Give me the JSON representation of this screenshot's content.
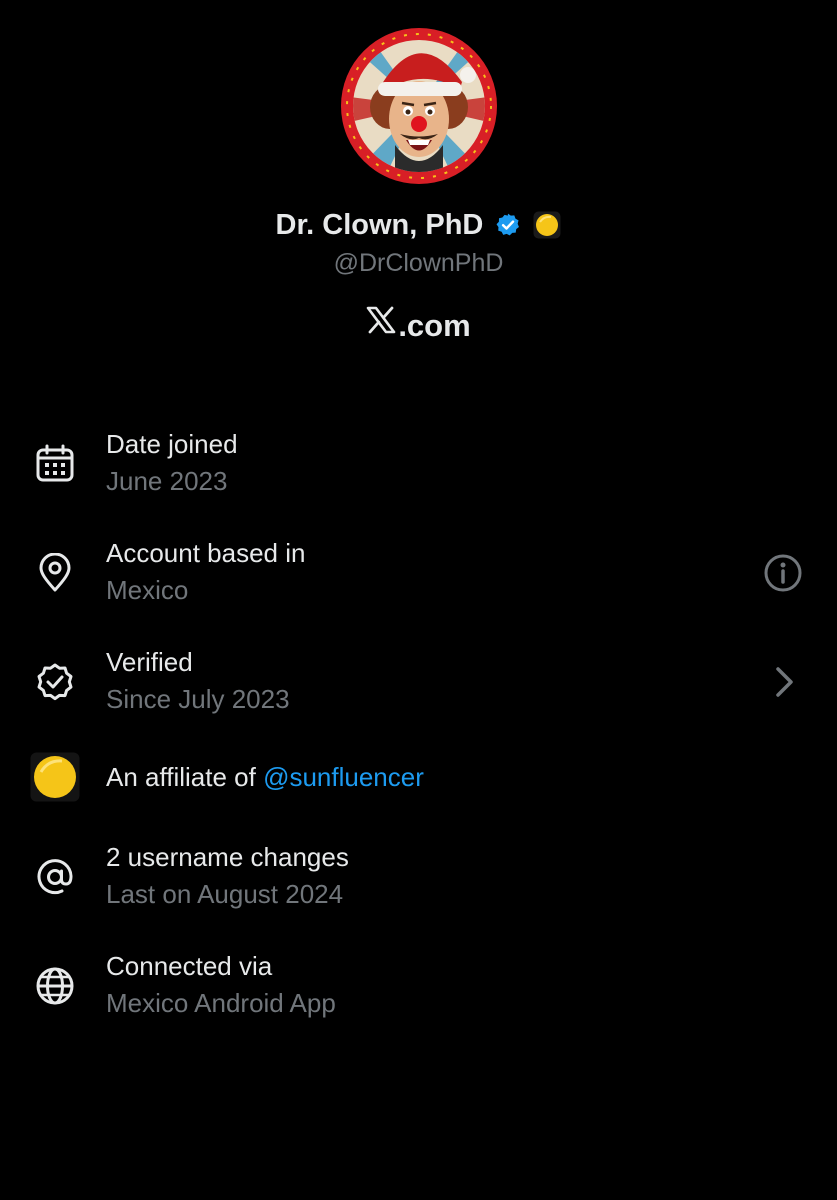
{
  "profile": {
    "display_name": "Dr. Clown, PhD",
    "handle": "@DrClownPhD",
    "site_label": ".com",
    "site_logo": "x-logo-icon",
    "verified_badge_color": "#1d9bf0",
    "affiliate_badge_color": "#f5c518"
  },
  "rows": {
    "date_joined": {
      "title": "Date joined",
      "value": "June 2023",
      "icon": "calendar-icon"
    },
    "account_based": {
      "title": "Account based in",
      "value": "Mexico",
      "icon": "location-pin-icon",
      "trailing": "info-icon"
    },
    "verified": {
      "title": "Verified",
      "value": "Since July 2023",
      "icon": "verified-seal-icon",
      "trailing": "chevron-right-icon"
    },
    "affiliate": {
      "prefix": "An affiliate of ",
      "link": "@sunfluencer",
      "icon": "affiliate-badge-icon"
    },
    "username_changes": {
      "title": "2 username changes",
      "value": "Last on August 2024",
      "icon": "at-sign-icon"
    },
    "connected": {
      "title": "Connected via",
      "value": "Mexico Android App",
      "icon": "globe-icon"
    }
  },
  "colors": {
    "background": "#000000",
    "primary_text": "#e7e9ea",
    "secondary_text": "#71767b",
    "link": "#1d9bf0",
    "avatar_ring": "#e0242b"
  }
}
